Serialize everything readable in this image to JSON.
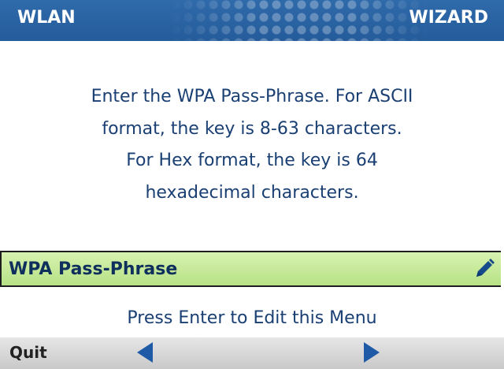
{
  "header": {
    "left_title": "WLAN",
    "right_title": "WIZARD"
  },
  "instructions": {
    "lines": [
      "Enter the WPA Pass-Phrase. For ASCII",
      "format, the key is 8-63 characters.",
      "For Hex format, the key is 64",
      "hexadecimal characters."
    ]
  },
  "menu": {
    "selected_item_label": "WPA Pass-Phrase",
    "edit_icon": "pencil-icon"
  },
  "hint": "Press Enter to Edit this Menu",
  "softkeys": {
    "left_label": "Quit",
    "prev_icon": "left-arrow-icon",
    "next_icon": "right-arrow-icon"
  },
  "colors": {
    "header_bg": "#2b64a4",
    "text_blue": "#1a3f73",
    "selection_green": "#c6ea99",
    "softkey_bg": "#d7d7d7",
    "arrow_blue": "#1f5aa6"
  }
}
